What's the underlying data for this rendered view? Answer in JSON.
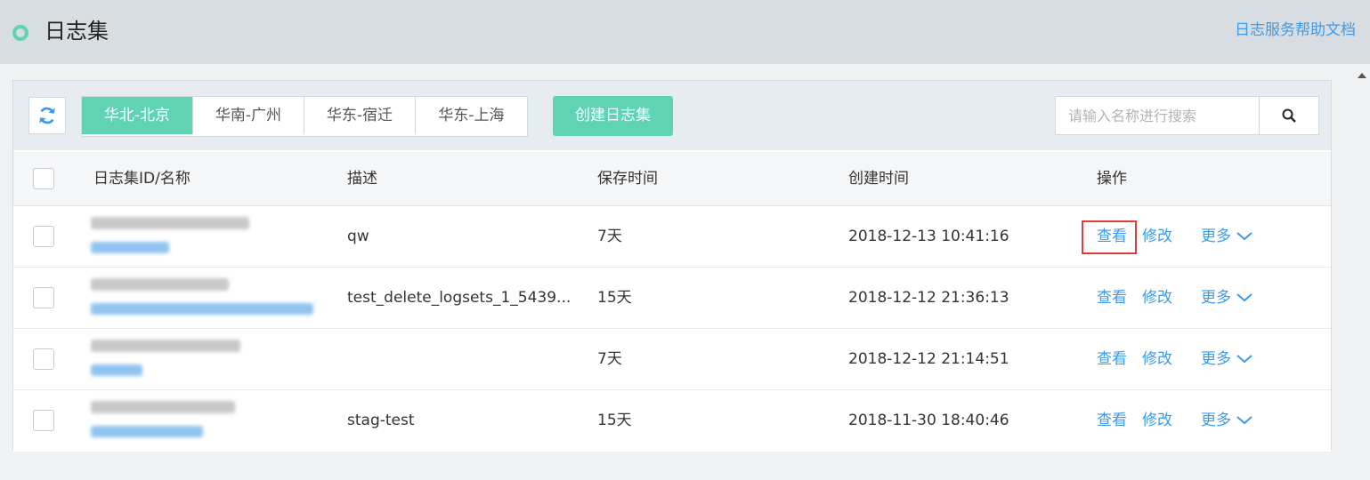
{
  "header": {
    "title": "日志集",
    "help_link": "日志服务帮助文档"
  },
  "toolbar": {
    "regions": [
      "华北-北京",
      "华南-广州",
      "华东-宿迁",
      "华东-上海"
    ],
    "active_region": "华北-北京",
    "create_label": "创建日志集",
    "search_placeholder": "请输入名称进行搜索"
  },
  "table": {
    "columns": [
      "日志集ID/名称",
      "描述",
      "保存时间",
      "创建时间",
      "操作"
    ],
    "rows": [
      {
        "description": "qw",
        "retention": "7天",
        "created": "2018-12-13 10:41:16"
      },
      {
        "description": "test_delete_logsets_1_5439...",
        "retention": "15天",
        "created": "2018-12-12 21:36:13"
      },
      {
        "description": "",
        "retention": "7天",
        "created": "2018-12-12 21:14:51"
      },
      {
        "description": "stag-test",
        "retention": "15天",
        "created": "2018-11-30 18:40:46"
      }
    ],
    "actions": {
      "view": "查看",
      "edit": "修改",
      "more": "更多"
    }
  },
  "icons": {
    "status": "status-ring-icon",
    "refresh": "refresh-icon",
    "search": "search-icon",
    "more": "chevron-down-icon"
  },
  "colors": {
    "accent": "#5fd3b3",
    "link": "#3e9ae8",
    "highlight": "#e53935"
  }
}
